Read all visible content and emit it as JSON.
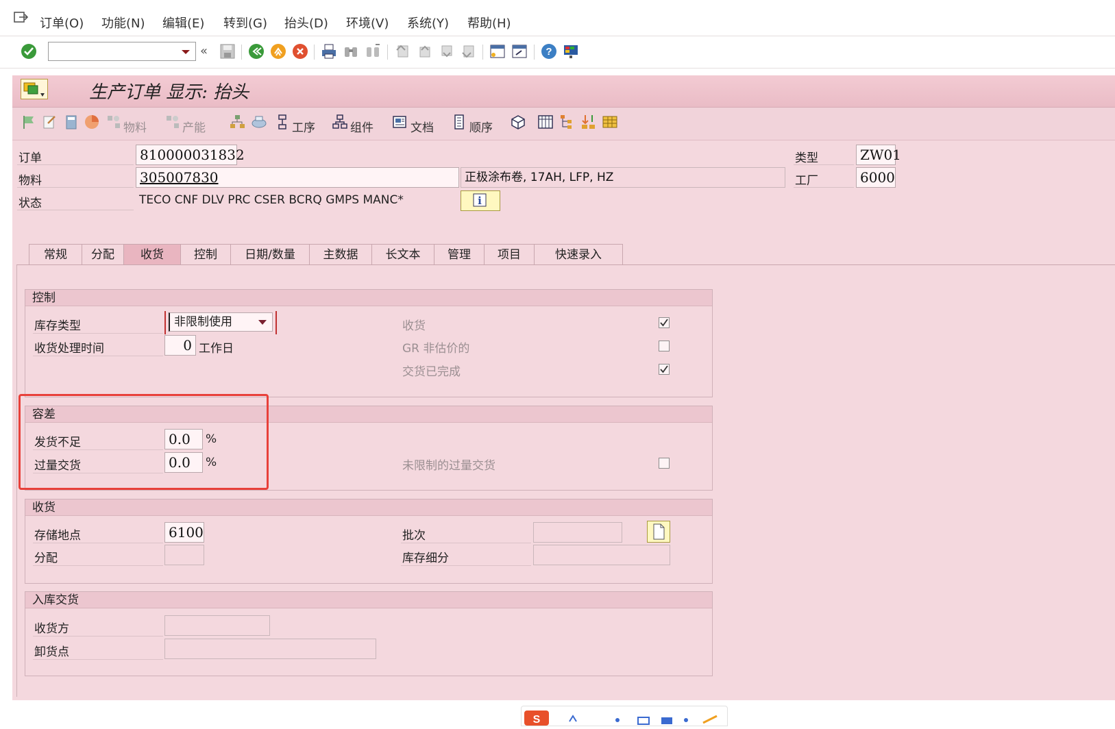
{
  "menu": {
    "items": [
      "订单(O)",
      "功能(N)",
      "编辑(E)",
      "转到(G)",
      "抬头(D)",
      "环境(V)",
      "系统(Y)",
      "帮助(H)"
    ]
  },
  "toolbar": {
    "command_field_value": ""
  },
  "page": {
    "title": "生产订单 显示: 抬头"
  },
  "app_toolbar": {
    "material": "物料",
    "capacity": "产能",
    "operations": "工序",
    "components": "组件",
    "documents": "文档",
    "sequences": "顺序"
  },
  "header": {
    "order_label": "订单",
    "order_value": "810000031832",
    "type_label": "类型",
    "type_value": "ZW01",
    "material_label": "物料",
    "material_value": "305007830",
    "material_desc": "正极涂布卷, 17AH,  LFP, HZ",
    "plant_label": "工厂",
    "plant_value": "6000",
    "status_label": "状态",
    "status_value": "TECO CNF  DLV  PRC  CSER BCRQ GMPS MANC*"
  },
  "tabs": [
    "常规",
    "分配",
    "收货",
    "控制",
    "日期/数量",
    "主数据",
    "长文本",
    "管理",
    "项目",
    "快速录入"
  ],
  "active_tab": "收货",
  "control_group": {
    "title": "控制",
    "stock_type_label": "库存类型",
    "stock_type_value": "非限制使用",
    "gr_processing_label": "收货处理时间",
    "gr_processing_value": "0",
    "gr_processing_unit": "工作日",
    "goods_receipt_label": "收货",
    "goods_receipt_checked": true,
    "gr_nonvaluated_label": "GR 非估价的",
    "gr_nonvaluated_checked": false,
    "delivery_completed_label": "交货已完成",
    "delivery_completed_checked": true
  },
  "tolerance_group": {
    "title": "容差",
    "underdelivery_label": "发货不足",
    "underdelivery_value": "0.0",
    "overdelivery_label": "过量交货",
    "overdelivery_value": "0.0",
    "percent": "%",
    "unlimited_overdelivery_label": "未限制的过量交货",
    "unlimited_overdelivery_checked": false
  },
  "receipt_group": {
    "title": "收货",
    "storage_location_label": "存储地点",
    "storage_location_value": "6100",
    "distribution_label": "分配",
    "distribution_value": "",
    "batch_label": "批次",
    "batch_value": "",
    "stock_segment_label": "库存细分",
    "stock_segment_value": ""
  },
  "warehouse_group": {
    "title": "入库交货",
    "goods_recipient_label": "收货方",
    "goods_recipient_value": "",
    "unloading_point_label": "卸货点",
    "unloading_point_value": ""
  },
  "colors": {
    "frame_bg": "#f4d8de",
    "title_bg": "#eabcc6",
    "highlight": "#e8403a",
    "ok_green": "#3a9a3a"
  }
}
